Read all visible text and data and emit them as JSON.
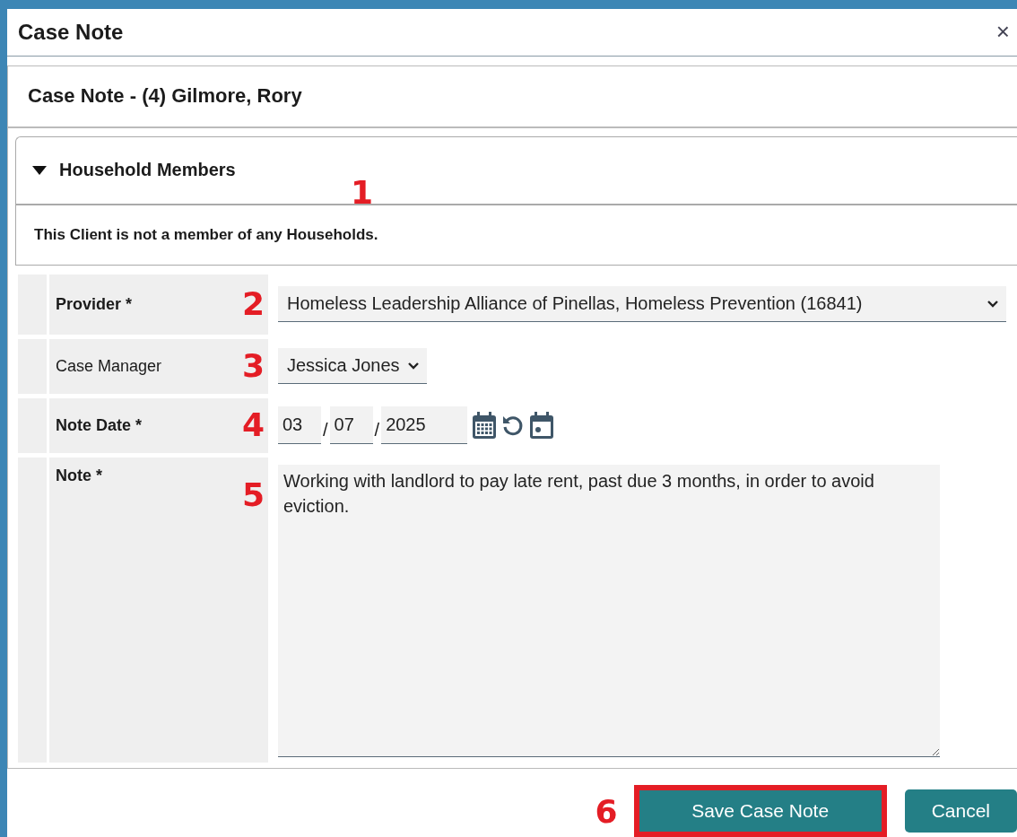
{
  "window": {
    "title": "Case Note",
    "close": "×"
  },
  "header": {
    "title": "Case Note - (4) Gilmore, Rory"
  },
  "household": {
    "title": "Household Members",
    "expanded": true,
    "message": "This Client is not a member of any Households.",
    "marker": "1"
  },
  "fields": [
    {
      "kind": "select",
      "label": "Provider",
      "required": true,
      "required_mark": "*",
      "marker": "2",
      "value": "Homeless Leadership Alliance of Pinellas, Homeless Prevention (16841)"
    },
    {
      "kind": "select",
      "label": "Case Manager",
      "required": false,
      "marker": "3",
      "value": "Jessica Jones"
    },
    {
      "kind": "date",
      "label": "Note Date",
      "required": true,
      "required_mark": "*",
      "marker": "4",
      "month": "03",
      "day": "07",
      "year": "2025",
      "separators": [
        "/",
        "/"
      ]
    },
    {
      "kind": "textarea",
      "label": "Note",
      "required": true,
      "required_mark": "*",
      "marker": "5",
      "value": "Working with landlord to pay late rent, past due 3 months, in order to avoid eviction."
    }
  ],
  "footer": {
    "marker": "6",
    "buttons": [
      {
        "label": "Save Case Note",
        "highlighted": true
      },
      {
        "label": "Cancel",
        "highlighted": false
      }
    ]
  }
}
